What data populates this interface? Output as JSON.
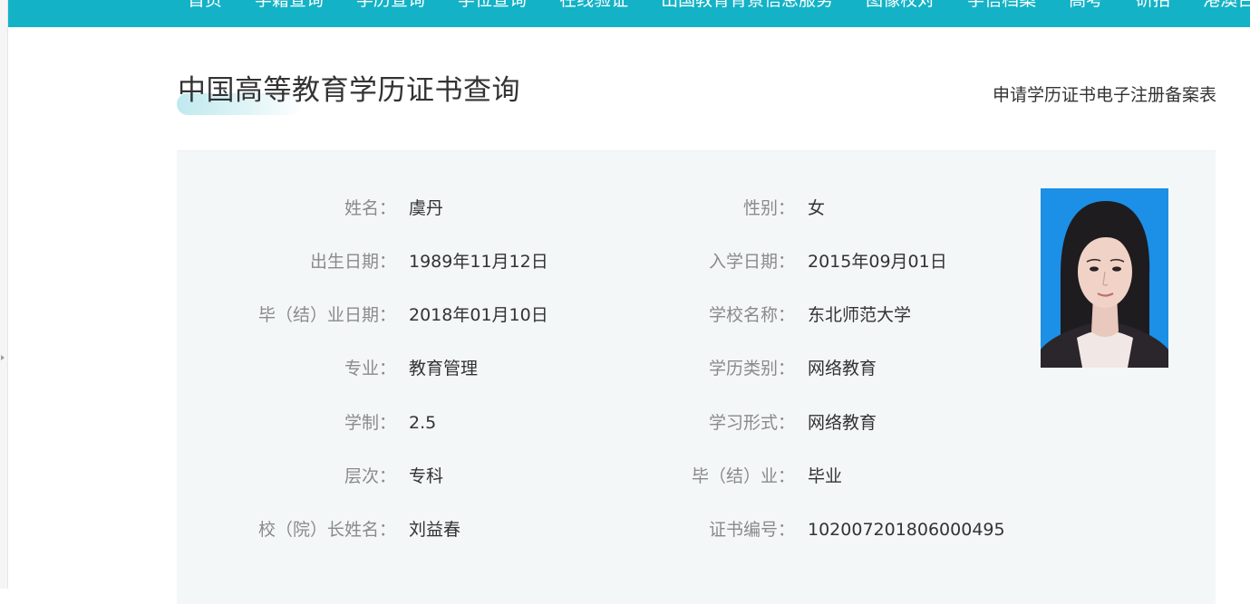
{
  "nav": {
    "items": [
      "首页",
      "学籍查询",
      "学历查询",
      "学位查询",
      "在线验证",
      "出国教育背景信息服务",
      "图像校对",
      "学信档案",
      "高考",
      "研招",
      "港澳台"
    ]
  },
  "page": {
    "title": "中国高等教育学历证书查询",
    "apply_link": "申请学历证书电子注册备案表"
  },
  "colors": {
    "nav_bg": "#14b2c6",
    "panel_bg": "#f4f7f8",
    "photo_bg": "#1c8fe6",
    "label_color": "#8a8a8a",
    "value_color": "#333333"
  },
  "record": {
    "left": [
      {
        "label": "姓名：",
        "value": "虞丹"
      },
      {
        "label": "出生日期：",
        "value": "1989年11月12日"
      },
      {
        "label": "毕（结）业日期：",
        "value": "2018年01月10日"
      },
      {
        "label": "专业：",
        "value": "教育管理"
      },
      {
        "label": "学制：",
        "value": "2.5"
      },
      {
        "label": "层次：",
        "value": "专科"
      },
      {
        "label": "校（院）长姓名：",
        "value": "刘益春"
      }
    ],
    "right": [
      {
        "label": "性别：",
        "value": "女"
      },
      {
        "label": "入学日期：",
        "value": "2015年09月01日"
      },
      {
        "label": "学校名称：",
        "value": "东北师范大学"
      },
      {
        "label": "学历类别：",
        "value": "网络教育"
      },
      {
        "label": "学习形式：",
        "value": "网络教育"
      },
      {
        "label": "毕（结）业：",
        "value": "毕业"
      },
      {
        "label": "证书编号：",
        "value": "102007201806000495"
      }
    ]
  },
  "photo_icon": "student-portrait"
}
